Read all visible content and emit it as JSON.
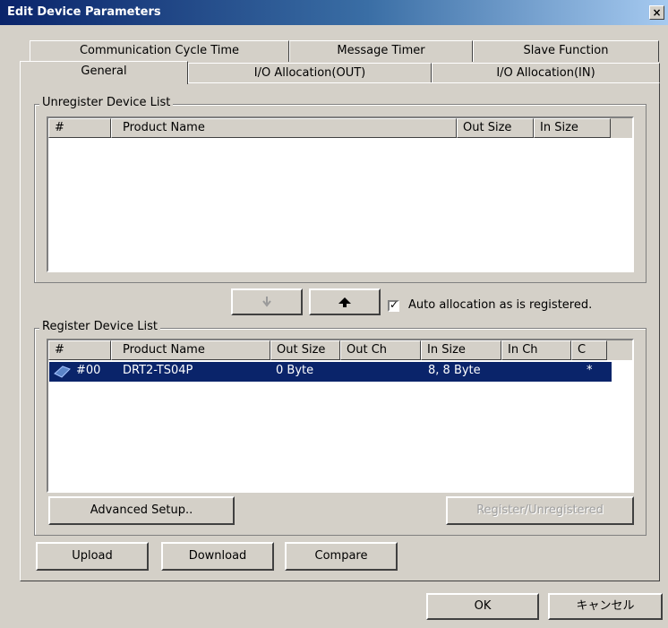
{
  "window": {
    "title": "Edit Device Parameters",
    "close_glyph": "×"
  },
  "tabs": {
    "row1": [
      "Communication Cycle Time",
      "Message Timer",
      "Slave Function"
    ],
    "row2": [
      "General",
      "I/O Allocation(OUT)",
      "I/O Allocation(IN)"
    ],
    "active": "General"
  },
  "unregister_list": {
    "label": "Unregister Device List",
    "columns": [
      "#",
      "Product Name",
      "Out Size",
      "In Size"
    ]
  },
  "move_buttons": {
    "down_icon": "arrow-down-icon",
    "up_icon": "arrow-up-icon"
  },
  "auto_allocation": {
    "label": "Auto allocation as is registered.",
    "checked": true,
    "mark": "✓"
  },
  "register_list": {
    "label": "Register Device List",
    "columns": [
      "#",
      "Product Name",
      "Out Size",
      "Out Ch",
      "In Size",
      "In Ch",
      "C"
    ],
    "rows": [
      {
        "num": "#00",
        "product": "DRT2-TS04P",
        "out_size": "0 Byte",
        "out_ch": "",
        "in_size": "8, 8 Byte",
        "in_ch": "",
        "c": "*"
      }
    ]
  },
  "buttons": {
    "advanced_setup": "Advanced Setup..",
    "register_unregistered": "Register/Unregistered",
    "upload": "Upload",
    "download": "Download",
    "compare": "Compare",
    "ok": "OK",
    "cancel": "キャンセル"
  },
  "colors": {
    "title_bar": "#0a246a",
    "selection": "#0a246a",
    "face": "#d4d0c8"
  }
}
